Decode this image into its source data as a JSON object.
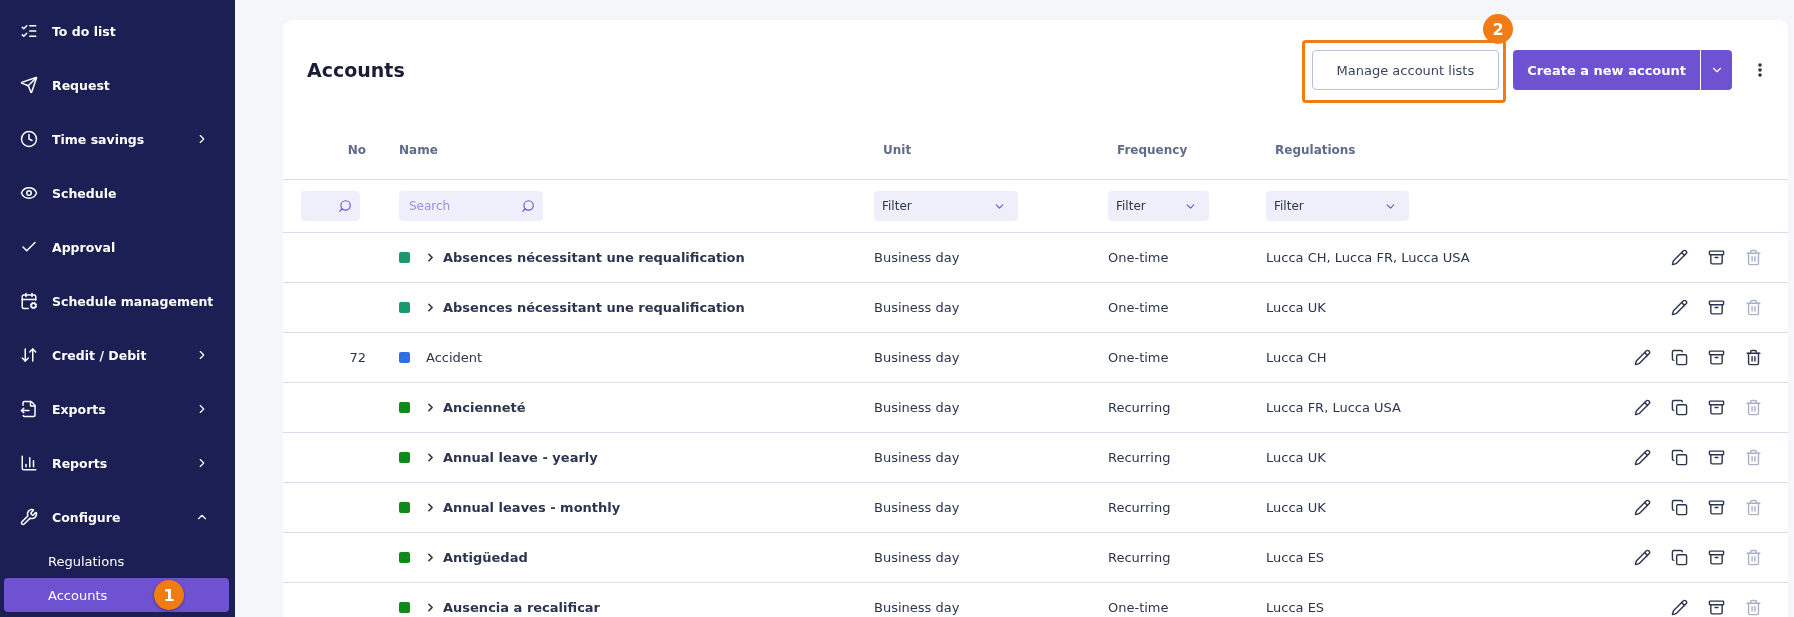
{
  "sidebar": {
    "items": [
      {
        "label": "To do list"
      },
      {
        "label": "Request"
      },
      {
        "label": "Time savings",
        "expanded": false
      },
      {
        "label": "Schedule"
      },
      {
        "label": "Approval"
      },
      {
        "label": "Schedule management"
      },
      {
        "label": "Credit / Debit",
        "expanded": false
      },
      {
        "label": "Exports",
        "expanded": false
      },
      {
        "label": "Reports",
        "expanded": false
      },
      {
        "label": "Configure",
        "expanded": true,
        "children": [
          {
            "label": "Regulations",
            "selected": false
          },
          {
            "label": "Accounts",
            "selected": true,
            "annotation": "1"
          }
        ]
      }
    ]
  },
  "page": {
    "title": "Accounts",
    "manage_button": {
      "label": "Manage account lists",
      "annotation": "2"
    },
    "create_button": {
      "label": "Create a new account"
    }
  },
  "table": {
    "columns": [
      {
        "label": "No",
        "kind": "search"
      },
      {
        "label": "Name",
        "kind": "search",
        "placeholder": "Search"
      },
      {
        "label": "Unit",
        "kind": "select",
        "value": "Filter"
      },
      {
        "label": "Frequency",
        "kind": "select",
        "value": "Filter"
      },
      {
        "label": "Regulations",
        "kind": "select",
        "value": "Filter"
      }
    ],
    "rows": [
      {
        "no": "",
        "name": "Absences nécessitant une requalification",
        "expandable": true,
        "color": "#1a9a6c",
        "unit": "Business day",
        "frequency": "One-time",
        "regulations": "Lucca CH, Lucca FR, Lucca USA",
        "copy": false,
        "delete_disabled": true
      },
      {
        "no": "",
        "name": "Absences nécessitant une requalification",
        "expandable": true,
        "color": "#1a9a6c",
        "unit": "Business day",
        "frequency": "One-time",
        "regulations": "Lucca UK",
        "copy": false,
        "delete_disabled": true
      },
      {
        "no": "72",
        "name": "Accident",
        "expandable": false,
        "color": "#2f6fe4",
        "unit": "Business day",
        "frequency": "One-time",
        "regulations": "Lucca CH",
        "copy": true,
        "delete_disabled": false
      },
      {
        "no": "",
        "name": "Ancienneté",
        "expandable": true,
        "color": "#0f8a1a",
        "unit": "Business day",
        "frequency": "Recurring",
        "regulations": "Lucca FR, Lucca USA",
        "copy": true,
        "delete_disabled": true
      },
      {
        "no": "",
        "name": "Annual leave - yearly",
        "expandable": true,
        "color": "#0f8a1a",
        "unit": "Business day",
        "frequency": "Recurring",
        "regulations": "Lucca UK",
        "copy": true,
        "delete_disabled": true
      },
      {
        "no": "",
        "name": "Annual leaves - monthly",
        "expandable": true,
        "color": "#0f8a1a",
        "unit": "Business day",
        "frequency": "Recurring",
        "regulations": "Lucca UK",
        "copy": true,
        "delete_disabled": true
      },
      {
        "no": "",
        "name": "Antigüedad",
        "expandable": true,
        "color": "#0f8a1a",
        "unit": "Business day",
        "frequency": "Recurring",
        "regulations": "Lucca ES",
        "copy": true,
        "delete_disabled": true
      },
      {
        "no": "",
        "name": "Ausencia a recalificar",
        "expandable": true,
        "color": "#0f8a1a",
        "unit": "Business day",
        "frequency": "One-time",
        "regulations": "Lucca ES",
        "copy": false,
        "delete_disabled": true
      }
    ]
  }
}
